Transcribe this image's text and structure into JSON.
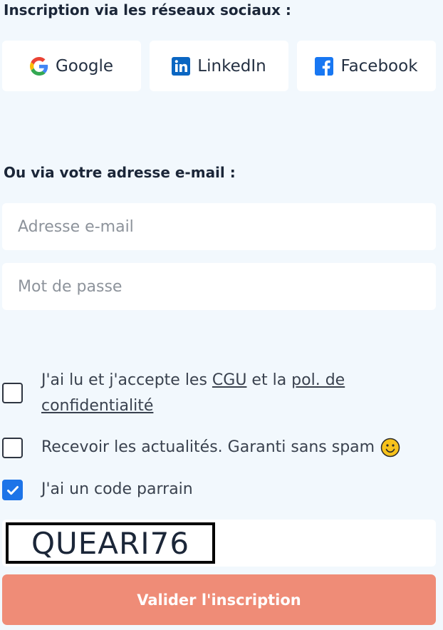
{
  "social": {
    "heading": "Inscription via les réseaux sociaux :",
    "buttons": [
      {
        "label": "Google",
        "icon": "google-icon"
      },
      {
        "label": "LinkedIn",
        "icon": "linkedin-icon"
      },
      {
        "label": "Facebook",
        "icon": "facebook-icon"
      }
    ]
  },
  "email_form": {
    "heading": "Ou via votre adresse e-mail :",
    "email_placeholder": "Adresse e-mail",
    "password_placeholder": "Mot de passe"
  },
  "consents": {
    "cgu": {
      "checked": false,
      "text_before": "J'ai lu et j'accepte les ",
      "cgu_link": "CGU",
      "text_middle": " et la ",
      "privacy_link": "pol. de confidentialité"
    },
    "newsletter": {
      "checked": false,
      "text": "Recevoir les actualités. Garanti sans spam",
      "emoji": "smiley-icon"
    },
    "referral": {
      "checked": true,
      "text": "J'ai un code parrain"
    }
  },
  "referral_code": "QUEARI76",
  "submit_label": "Valider l'inscription",
  "colors": {
    "background": "#f2f8fd",
    "submit": "#ef8c77",
    "checkbox_checked": "#1d74e8",
    "linkedin": "#0a66c2",
    "facebook": "#1877f2"
  }
}
